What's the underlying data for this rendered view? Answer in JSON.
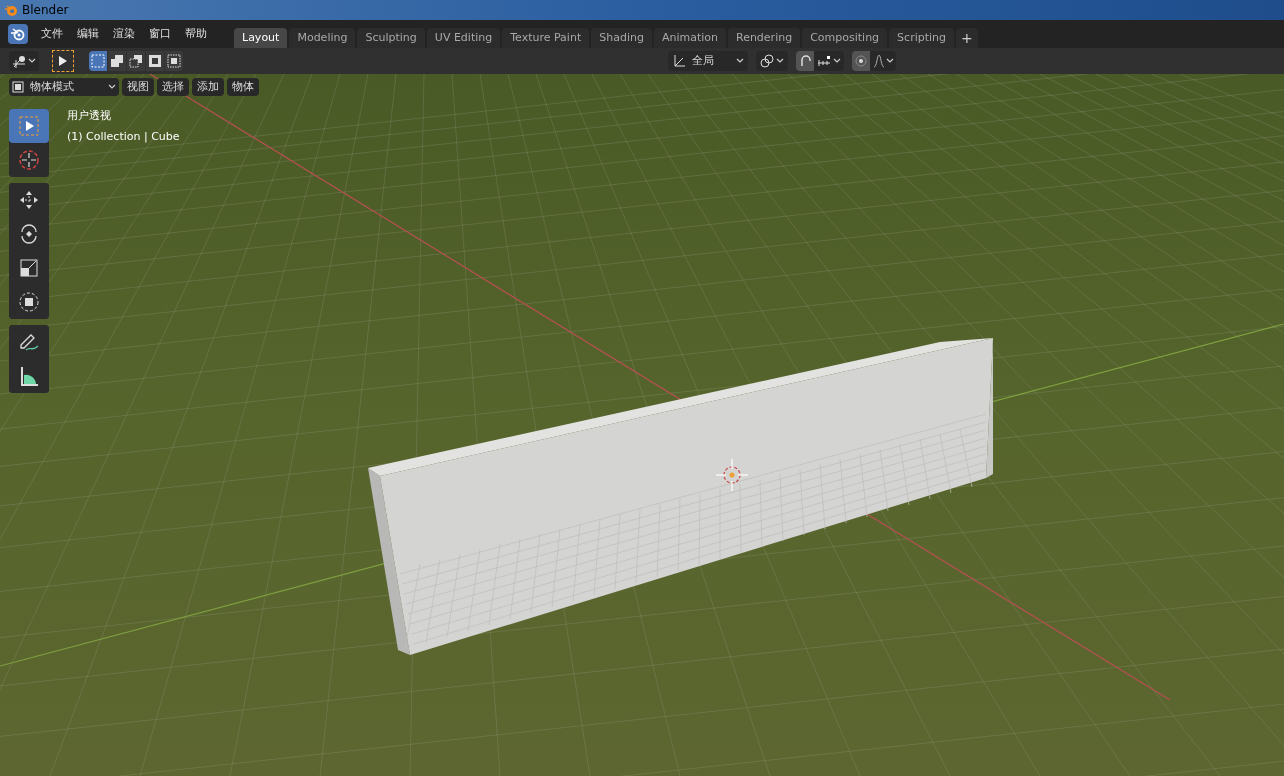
{
  "window": {
    "title": "Blender"
  },
  "menu": [
    "文件",
    "编辑",
    "渲染",
    "窗口",
    "帮助"
  ],
  "workspace_tabs": [
    {
      "label": "Layout",
      "selected": true
    },
    {
      "label": "Modeling",
      "selected": false
    },
    {
      "label": "Sculpting",
      "selected": false
    },
    {
      "label": "UV Editing",
      "selected": false
    },
    {
      "label": "Texture Paint",
      "selected": false
    },
    {
      "label": "Shading",
      "selected": false
    },
    {
      "label": "Animation",
      "selected": false
    },
    {
      "label": "Rendering",
      "selected": false
    },
    {
      "label": "Compositing",
      "selected": false
    },
    {
      "label": "Scripting",
      "selected": false
    }
  ],
  "add_tab": "+",
  "tool_header": {
    "select_modes": [
      {
        "kind": "set",
        "selected": true
      },
      {
        "kind": "extend",
        "selected": false
      },
      {
        "kind": "subtract",
        "selected": false
      },
      {
        "kind": "invert",
        "selected": false
      },
      {
        "kind": "intersect",
        "selected": false
      }
    ],
    "orientation": "全局",
    "snap_on": false,
    "proportional_on": false
  },
  "viewport_header": {
    "mode": "物体模式",
    "menus": [
      "视图",
      "选择",
      "添加",
      "物体"
    ]
  },
  "viewport": {
    "view_name": "用户透视",
    "object_info": "(1) Collection | Cube"
  },
  "toolbar": [
    {
      "kind": "select",
      "selected": true
    },
    {
      "kind": "cursor",
      "selected": false
    },
    {
      "kind": "move",
      "selected": false
    },
    {
      "kind": "rotate",
      "selected": false
    },
    {
      "kind": "scale",
      "selected": false
    },
    {
      "kind": "transform",
      "selected": false
    },
    {
      "kind": "annotate",
      "selected": false
    },
    {
      "kind": "measure",
      "selected": false
    }
  ]
}
